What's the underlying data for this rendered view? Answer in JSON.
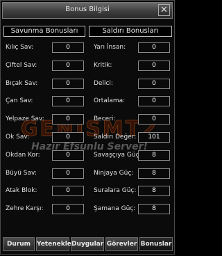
{
  "window": {
    "title": "Bonus Bilgisi",
    "close_glyph": "✕"
  },
  "headers": {
    "left": "Savunma Bonusları",
    "right": "Saldırı Bonusları"
  },
  "left_stats": [
    {
      "label": "Kılıç Sav:",
      "value": "0"
    },
    {
      "label": "Çiftel Sav:",
      "value": "0"
    },
    {
      "label": "Bıçak Sav:",
      "value": "0"
    },
    {
      "label": "Çan Sav:",
      "value": "0"
    },
    {
      "label": "Yelpaze Sav:",
      "value": "0"
    },
    {
      "label": "Ok Sav:",
      "value": "0"
    },
    {
      "label": "Okdan Kor:",
      "value": "0"
    },
    {
      "label": "Büyü Sav:",
      "value": "0"
    },
    {
      "label": "Atak Blok:",
      "value": "0"
    },
    {
      "label": "Zehre Karşı:",
      "value": "0"
    }
  ],
  "right_stats": [
    {
      "label": "Yarı İnsan:",
      "value": "0"
    },
    {
      "label": "Kritik:",
      "value": "0"
    },
    {
      "label": "Delici:",
      "value": "0"
    },
    {
      "label": "Ortalama:",
      "value": "0"
    },
    {
      "label": "Beceri:",
      "value": "0"
    },
    {
      "label": "Saldırı Değer:",
      "value": "101"
    },
    {
      "label": "Savaşçıya Güç:",
      "value": "8"
    },
    {
      "label": "Ninjaya Güç:",
      "value": "8"
    },
    {
      "label": "Suralara Güç:",
      "value": "8"
    },
    {
      "label": "Şamana Güç:",
      "value": "8"
    }
  ],
  "watermark": {
    "logo_text": "GENISMT2",
    "tagline": "Hazır Efsunlu Server!"
  },
  "tabs": [
    {
      "label": "Durum",
      "active": false
    },
    {
      "label": "Yetenekler",
      "active": false
    },
    {
      "label": "Duygular",
      "active": false
    },
    {
      "label": "Görevler",
      "active": false
    },
    {
      "label": "Bonuslar",
      "active": true
    }
  ]
}
